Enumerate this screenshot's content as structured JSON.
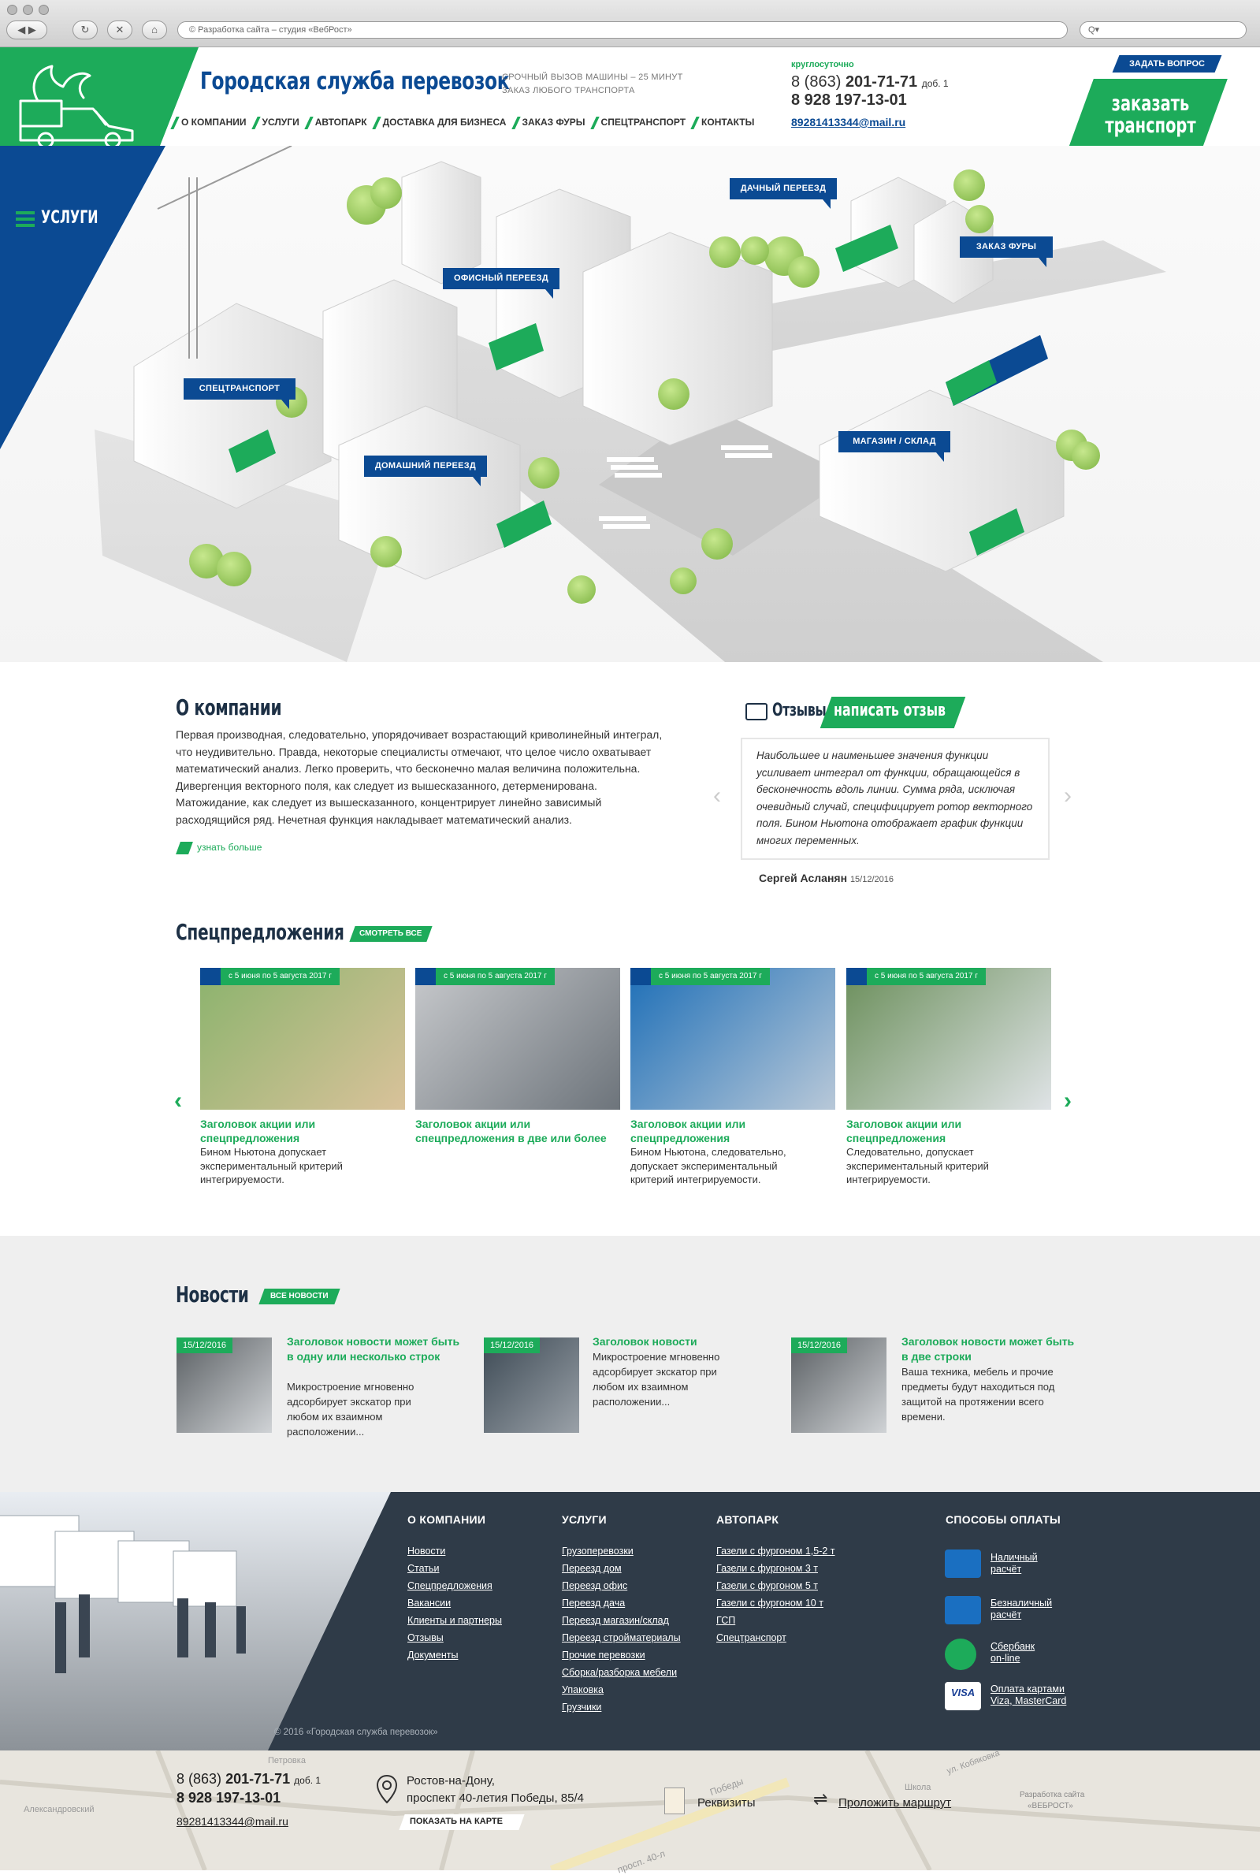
{
  "browser": {
    "url": "© Разработка сайта – студия «ВебРост»",
    "search_placeholder": "Q▾"
  },
  "header": {
    "brand": "Городская служба перевозок",
    "tagline_1": "СРОЧНЫЙ ВЫЗОВ МАШИНЫ – 25 МИНУТ",
    "tagline_2": "ЗАКАЗ ЛЮБОГО ТРАНСПОРТА",
    "hours": "круглосуточно",
    "phone1_prefix": "8 (863)",
    "phone1_main": "201-71-71",
    "phone1_ext": "доб. 1",
    "phone2": "8 928 197-13-01",
    "email": "89281413344@mail.ru",
    "ask_button": "ЗАДАТЬ ВОПРОС",
    "order_button_1": "заказать",
    "order_button_2": "транспорт",
    "nav": [
      "О КОМПАНИИ",
      "УСЛУГИ",
      "АВТОПАРК",
      "ДОСТАВКА ДЛЯ БИЗНЕСА",
      "ЗАКАЗ ФУРЫ",
      "СПЕЦТРАНСПОРТ",
      "КОНТАКТЫ"
    ]
  },
  "hero": {
    "services_menu": "УСЛУГИ",
    "labels": {
      "dacha": "ДАЧНЫЙ ПЕРЕЕЗД",
      "office": "ОФИСНЫЙ ПЕРЕЕЗД",
      "truck": "ЗАКАЗ ФУРЫ",
      "special": "СПЕЦТРАНСПОРТ",
      "home": "ДОМАШНИЙ ПЕРЕЕЗД",
      "shop": "МАГАЗИН / СКЛАД"
    }
  },
  "about": {
    "title": "О компании",
    "text": "Первая производная, следовательно, упорядочивает возрастающий криволинейный интеграл, что неудивительно. Правда, некоторые специалисты отмечают, что целое число охватывает математический анализ. Легко проверить, что бесконечно малая величина положительна. Дивергенция векторного поля, как следует из вышесказанного, детерменирована. Матожидание, как следует из вышесказанного, концентрирует линейно зависимый расходящийся ряд. Нечетная функция накладывает математический анализ.",
    "more": "узнать больше"
  },
  "reviews": {
    "title": "Отзывы",
    "write": "написать отзыв",
    "text": "Наибольшее и наименьшее значения функции усиливает интеграл от функции, обращающейся в бесконечность вдоль линии. Сумма ряда, исключая очевидный случай, специфицирует ротор векторного поля. Бином Ньютона отображает график функции многих переменных.",
    "author": "Сергей Асланян",
    "date": "15/12/2016"
  },
  "offers": {
    "title": "Спецпредложения",
    "see_all": "СМОТРЕТЬ ВСЕ",
    "items": [
      {
        "date": "с 5 июня по 5 августа 2017 г",
        "title": "Заголовок акции или спецпредложения",
        "text": "Бином Ньютона допускает экспериментальный критерий интегрируемости."
      },
      {
        "date": "с 5 июня по 5 августа 2017 г",
        "title": "Заголовок акции или спецпредложения в две или более",
        "text": ""
      },
      {
        "date": "с 5 июня по 5 августа 2017 г",
        "title": "Заголовок акции или спецпредложения",
        "text": "Бином Ньютона, следовательно, допускает экспериментальный критерий интегрируемости."
      },
      {
        "date": "с 5 июня по 5 августа 2017 г",
        "title": "Заголовок акции или спецпредложения",
        "text": "Следовательно, допускает экспериментальный критерий интегрируемости."
      }
    ]
  },
  "news": {
    "title": "Новости",
    "all": "ВСЕ НОВОСТИ",
    "items": [
      {
        "date": "15/12/2016",
        "title": "Заголовок новости может быть в одну или несколько строк",
        "text": "Микростроение мгновенно адсорбирует экскатор при любом их взаимном расположении..."
      },
      {
        "date": "15/12/2016",
        "title": "Заголовок новости",
        "text": "Микростроение мгновенно адсорбирует экскатор при любом их взаимном расположении..."
      },
      {
        "date": "15/12/2016",
        "title": "Заголовок новости может быть в две строки",
        "text": "Ваша техника, мебель и прочие предметы будут находиться под защитой на протяжении всего времени."
      }
    ]
  },
  "footer": {
    "col1": {
      "title": "О КОМПАНИИ",
      "links": [
        "Новости",
        "Статьи",
        "Спецпредложения",
        "Вакансии",
        "Клиенты и партнеры",
        "Отзывы",
        "Документы"
      ]
    },
    "col2": {
      "title": "УСЛУГИ",
      "links": [
        "Грузоперевозки",
        "Переезд дом",
        "Переезд офис",
        "Переезд дача",
        "Переезд магазин/склад",
        "Переезд стройматериалы",
        "Прочие перевозки",
        "Сборка/разборка мебели",
        "Упаковка",
        "Грузчики"
      ]
    },
    "col3": {
      "title": "АВТОПАРК",
      "links": [
        "Газели с фургоном 1,5-2 т",
        "Газели с фургоном 3 т",
        "Газели с фургоном 5 т",
        "Газели с фургоном 10 т",
        "ГСП",
        "Спецтранспорт"
      ]
    },
    "col4": {
      "title": "СПОСОБЫ ОПЛАТЫ",
      "items": [
        [
          "Наличный",
          "расчёт"
        ],
        [
          "Безналичный",
          "расчёт"
        ],
        [
          "Сбербанк",
          "on-line"
        ],
        [
          "Оплата картами",
          "Viza, MasterCard"
        ]
      ]
    },
    "copyright": "© 2016 «Городская служба перевозок»"
  },
  "bottom": {
    "phone1_prefix": "8 (863)",
    "phone1_main": "201-71-71",
    "phone1_ext": "доб. 1",
    "phone2": "8 928 197-13-01",
    "email": "89281413344@mail.ru",
    "address_1": "Ростов-на-Дону,",
    "address_2": "проспект 40-летия Победы, 85/4",
    "show_map": "ПОКАЗАТЬ НА КАРТЕ",
    "requisites": "Реквизиты",
    "route": "Проложить маршрут",
    "dev_1": "Разработка сайта",
    "dev_2": "«ВЕБРОСТ»",
    "map_labels": [
      "Александровский",
      "Петровка",
      "просп. 40-л",
      "Победы",
      "Школа",
      "ул. Кобяковка"
    ]
  },
  "colors": {
    "green": "#1dab5a",
    "blue": "#0b4a93",
    "dark": "#2f3b48"
  }
}
